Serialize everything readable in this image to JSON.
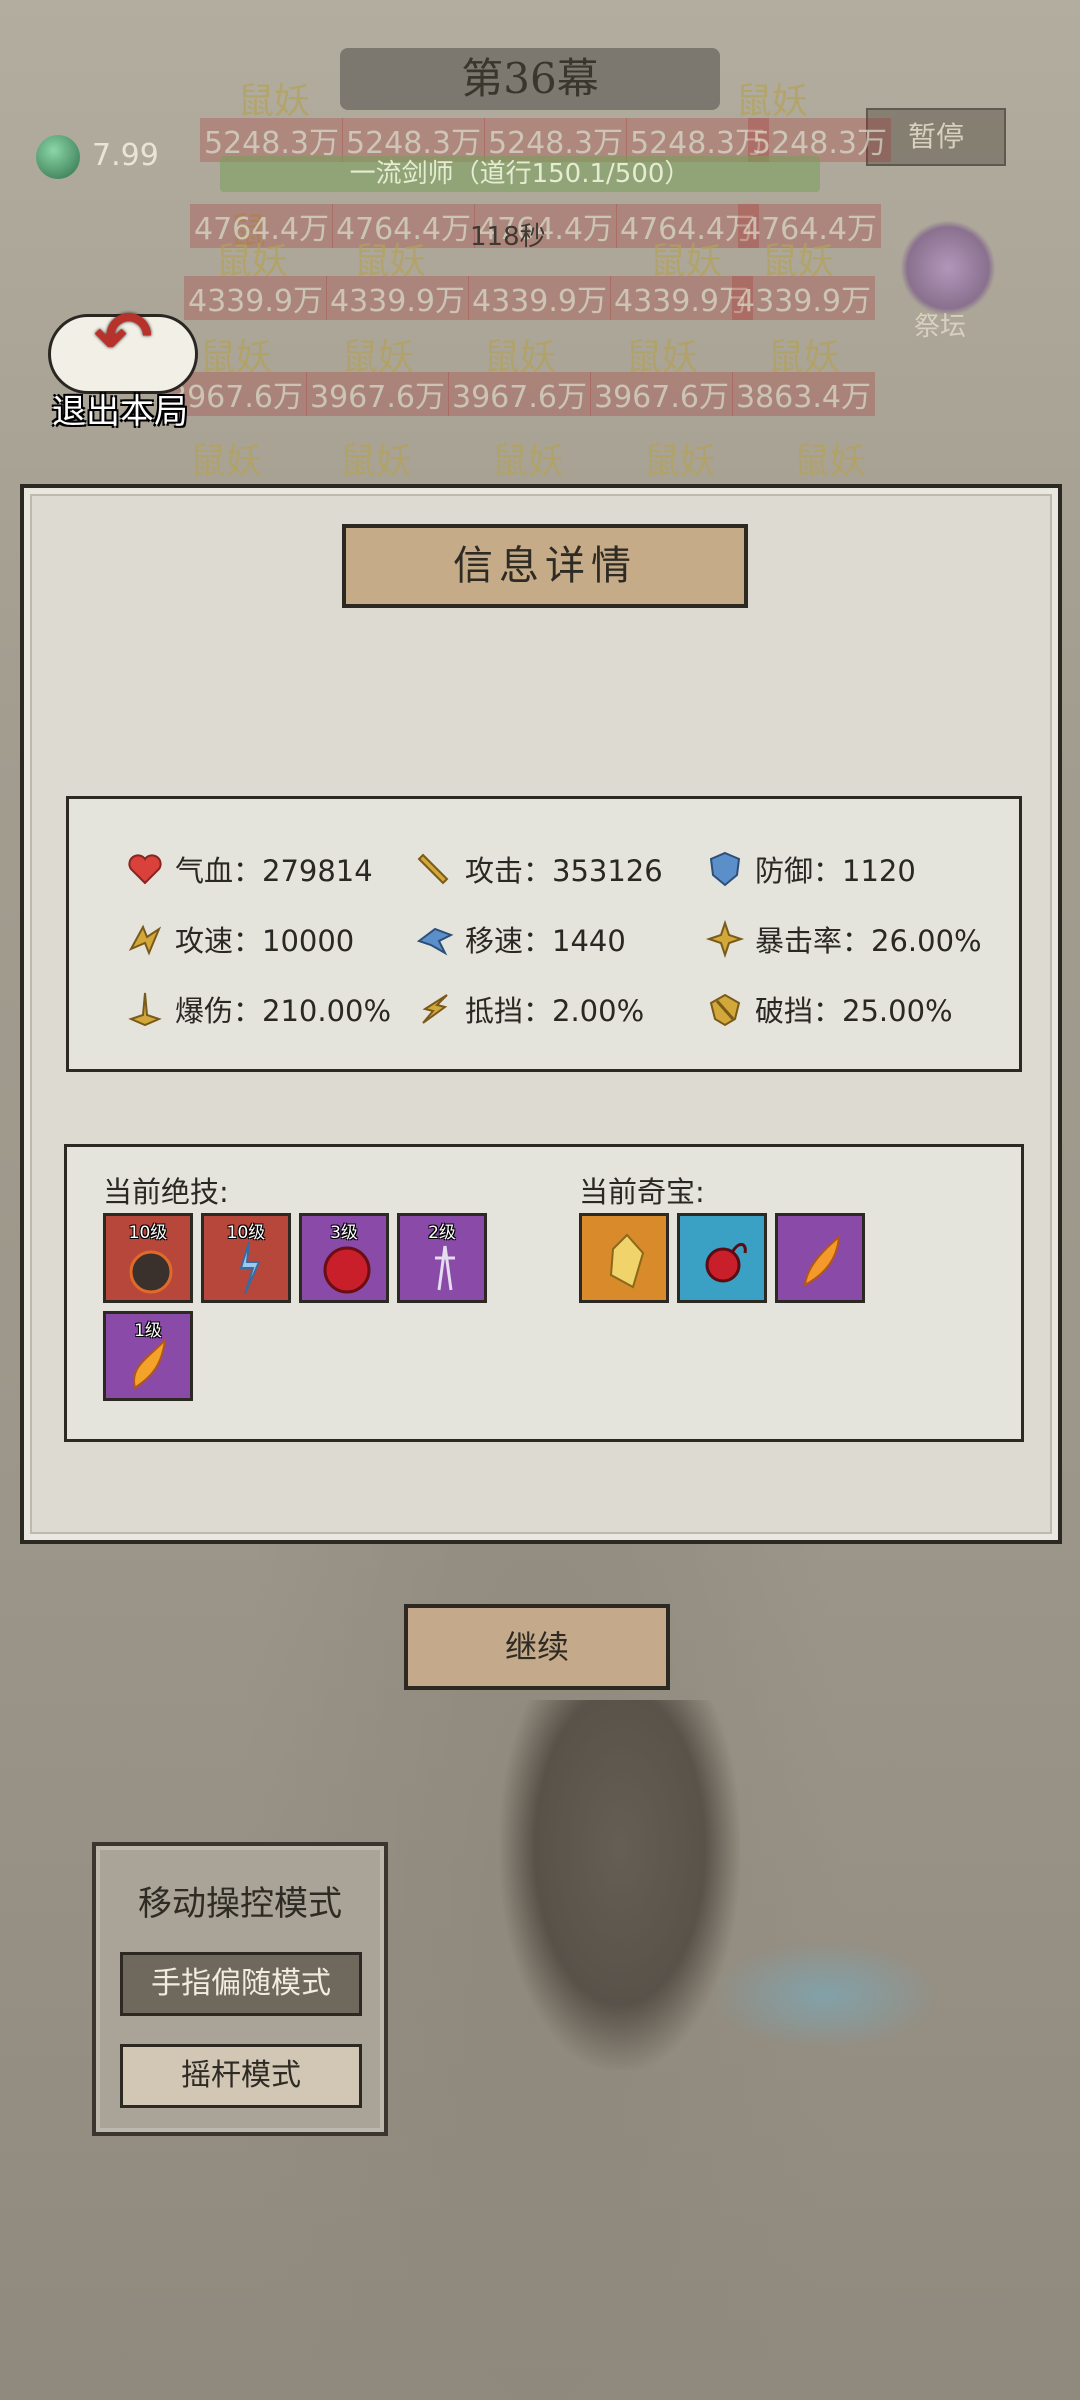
{
  "hud": {
    "stage_title": "第36幕",
    "timer": "7.99",
    "pause_label": "暂停",
    "rank_text": "一流剑师（道行150.1/500）",
    "wave_text": "118秒",
    "altar_label": "祭坛",
    "exit_label": "退出本局"
  },
  "enemies": {
    "rows": [
      {
        "names": [
          "鼠妖",
          "鼠妖"
        ],
        "hp": [
          "5248.3万",
          "5248.3万",
          "5248.3万",
          "5248.3万",
          "5248.3万"
        ]
      },
      {
        "names": [
          "鼠"
        ],
        "hp": [
          "4764.4万",
          "4764.4万",
          "4764.4万",
          "4764.4万",
          "4764.4万"
        ]
      },
      {
        "names": [
          "鼠妖",
          "鼠妖",
          "鼠妖",
          "鼠妖"
        ],
        "hp": [
          "4339.9万",
          "4339.9万",
          "4339.9万",
          "4339.9万",
          "4339.9万"
        ]
      },
      {
        "names": [
          "鼠妖",
          "鼠妖",
          "鼠妖",
          "鼠妖",
          "鼠妖"
        ],
        "hp": [
          "3967.6万",
          "3967.6万",
          "3967.6万",
          "3967.6万",
          "3863.4万"
        ]
      },
      {
        "names": [
          "鼠妖",
          "鼠妖",
          "鼠妖",
          "鼠妖",
          "鼠妖"
        ],
        "hp": []
      }
    ]
  },
  "dialog": {
    "title": "信息详情",
    "stats": [
      {
        "icon": "heart-icon",
        "label": "气血：279814",
        "color": "#d9413a"
      },
      {
        "icon": "sword-icon",
        "label": "攻击：353126",
        "color": "#d2a83b"
      },
      {
        "icon": "shield-icon",
        "label": "防御：1120",
        "color": "#5b8fc9"
      },
      {
        "icon": "attack-speed-icon",
        "label": "攻速：10000",
        "color": "#d2a83b"
      },
      {
        "icon": "move-speed-icon",
        "label": "移速：1440",
        "color": "#5b8fc9"
      },
      {
        "icon": "crit-rate-icon",
        "label": "暴击率：26.00%",
        "color": "#d2a83b"
      },
      {
        "icon": "crit-damage-icon",
        "label": "爆伤：210.00%",
        "color": "#d2a83b"
      },
      {
        "icon": "block-icon",
        "label": "抵挡：2.00%",
        "color": "#d2a83b"
      },
      {
        "icon": "armor-break-icon",
        "label": "破挡：25.00%",
        "color": "#d2a83b"
      }
    ],
    "skills_label": "当前绝技:",
    "skills": [
      {
        "level": "10级",
        "icon": "meteor-skill-icon",
        "bg": "#b8473b"
      },
      {
        "level": "10级",
        "icon": "lightning-skill-icon",
        "bg": "#b8473b"
      },
      {
        "level": "3级",
        "icon": "blood-orb-skill-icon",
        "bg": "#8a4aa8"
      },
      {
        "level": "2级",
        "icon": "spirit-skill-icon",
        "bg": "#8a4aa8"
      },
      {
        "level": "1级",
        "icon": "flame-wing-skill-icon",
        "bg": "#8a4aa8"
      }
    ],
    "treasures_label": "当前奇宝:",
    "treasures": [
      {
        "icon": "gold-crystal-treasure-icon",
        "bg": "#d98a2a"
      },
      {
        "icon": "red-bead-treasure-icon",
        "bg": "#3aa0c4"
      },
      {
        "icon": "fire-feather-treasure-icon",
        "bg": "#8a4aa8"
      }
    ]
  },
  "continue_label": "继续",
  "move_control": {
    "title": "移动操控模式",
    "finger_mode": "手指偏随模式",
    "joystick_mode": "摇杆模式"
  }
}
